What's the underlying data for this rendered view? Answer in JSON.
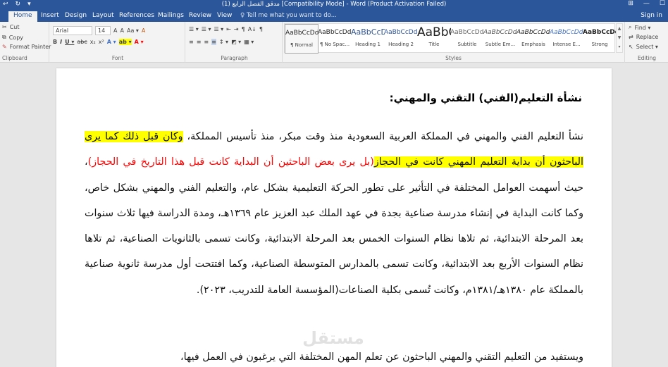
{
  "titlebar": {
    "title": "مدقق الفصل الرابع (1) [Compatibility Mode] - Word (Product Activation Failed)",
    "qat": [
      "↩",
      "↻",
      "▾"
    ],
    "controls": [
      "⊞",
      "—",
      "☐"
    ]
  },
  "tabs": [
    "Home",
    "Insert",
    "Design",
    "Layout",
    "References",
    "Mailings",
    "Review",
    "View"
  ],
  "tell_me": "Tell me what you want to do...",
  "sign_in": "Sign in",
  "clipboard": {
    "cut": "Cut",
    "copy": "Copy",
    "format_painter": "Format Painter",
    "label": "Clipboard"
  },
  "font": {
    "name": "Arial",
    "size": "14",
    "label": "Font",
    "row1": [
      "A",
      "A",
      "Aa ▾",
      "A"
    ],
    "row2": [
      "B",
      "I",
      "U ▾",
      "abc",
      "x₂",
      "x²",
      "A ▾",
      "ab ▾",
      "A ▾"
    ]
  },
  "paragraph": {
    "label": "Paragraph",
    "row1": [
      "☰ ▾",
      "☰ ▾",
      "☰ ▾",
      "⇤",
      "⇥",
      "¶",
      "A↓",
      "¶"
    ],
    "row2": [
      "≡",
      "≡",
      "≡",
      "≡",
      "↕ ▾",
      "◩ ▾",
      "▦ ▾"
    ]
  },
  "styles": {
    "label": "Styles",
    "items": [
      {
        "preview": "AaBbCcDdEe",
        "label": "¶ Normal"
      },
      {
        "preview": "AaBbCcDdEe",
        "label": "¶ No Spac..."
      },
      {
        "preview": "AaBbCcDdEe",
        "label": "Heading 1"
      },
      {
        "preview": "AaBbCcDdEe",
        "label": "Heading 2"
      },
      {
        "preview": "AaBbCcDdEe",
        "label": "Title"
      },
      {
        "preview": "AaBbCcDdEe",
        "label": "Subtitle"
      },
      {
        "preview": "AaBbCcDdEe",
        "label": "Subtle Em..."
      },
      {
        "preview": "AaBbCcDdEe",
        "label": "Emphasis"
      },
      {
        "preview": "AaBbCcDdEe",
        "label": "Intense E..."
      },
      {
        "preview": "AaBbCcDdEe",
        "label": "Strong"
      }
    ]
  },
  "editing": {
    "find": "Find ▾",
    "replace": "Replace",
    "select": "Select ▾",
    "label": "Editing"
  },
  "document": {
    "heading": "نشأة التعليم(الفني) التقني والمهني:",
    "p1": {
      "a": "نشأ التعليم الفني والمهني في المملكة العربية السعودية منذ وقت مبكر، منذ تأسيس المملكة، ",
      "b": "وكان قبل ذلك كما يرى الباحثون أن بداية التعليم المهني كانت في الحجاز",
      "c": "(بل يرى بعض الباحثين أن البداية كانت قبل هذا التاريخ في الحجاز)",
      "d": "، حيث أسهمت العوامل المختلفة في التأثير على تطور الحركة التعليمية بشكل عام، والتعليم الفني والمهني بشكل خاص، وكما كانت البداية في إنشاء مدرسة صناعية بجدة في عهد الملك عبد العزيز عام ١٣٦٩هـ، ومدة الدراسة فيها ثلاث سنوات بعد المرحلة الابتدائية، ثم تلاها نظام السنوات الخمس بعد المرحلة الابتدائية، وكانت تسمى بالثانويات الصناعية، ثم تلاها نظام السنوات الأربع بعد الابتدائية، وكانت تسمى بالمدارس المتوسطة الصناعية، وكما افتتحت أول مدرسة ثانوية صناعية بالمملكة عام ١٣٨٠هـ/١٣٨١م، وكانت تُسمى بكلية الصناعات(المؤسسة العامة للتدريب، ٢٠٢٣)."
    },
    "p2": "ويستفيد من التعليم التقني والمهني الباحثون عن تعلم المهن المختلفة التي يرغبون في العمل فيها،",
    "watermark": "مستقل"
  }
}
